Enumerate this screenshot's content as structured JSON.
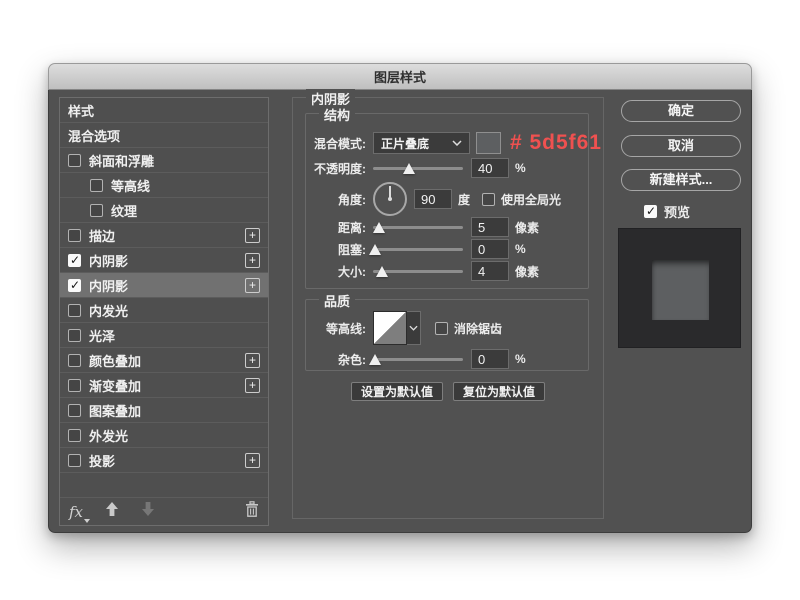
{
  "window": {
    "title": "图层样式"
  },
  "annotation": {
    "text": "# 5d5f61",
    "color": "#ef5150"
  },
  "colors": {
    "annotated_swatch": "#5d5f61",
    "dialog_bg": "#515151",
    "preview_bg": "#2a2a2c"
  },
  "sidebar": {
    "items": [
      {
        "id": "styles",
        "label": "样式"
      },
      {
        "id": "blending-options",
        "label": "混合选项"
      },
      {
        "id": "bevel-emboss",
        "label": "斜面和浮雕",
        "checkbox": true,
        "checked": false
      },
      {
        "id": "contour",
        "label": "等高线",
        "checkbox": true,
        "checked": false,
        "indent": true
      },
      {
        "id": "texture",
        "label": "纹理",
        "checkbox": true,
        "checked": false,
        "indent": true
      },
      {
        "id": "stroke",
        "label": "描边",
        "checkbox": true,
        "checked": false,
        "plus": true
      },
      {
        "id": "inner-shadow-1",
        "label": "内阴影",
        "checkbox": true,
        "checked": true,
        "plus": true
      },
      {
        "id": "inner-shadow-2",
        "label": "内阴影",
        "checkbox": true,
        "checked": true,
        "plus": true,
        "selected": true
      },
      {
        "id": "inner-glow",
        "label": "内发光",
        "checkbox": true,
        "checked": false
      },
      {
        "id": "satin",
        "label": "光泽",
        "checkbox": true,
        "checked": false
      },
      {
        "id": "color-overlay",
        "label": "颜色叠加",
        "checkbox": true,
        "checked": false,
        "plus": true
      },
      {
        "id": "gradient-overlay",
        "label": "渐变叠加",
        "checkbox": true,
        "checked": false,
        "plus": true
      },
      {
        "id": "pattern-overlay",
        "label": "图案叠加",
        "checkbox": true,
        "checked": false
      },
      {
        "id": "outer-glow",
        "label": "外发光",
        "checkbox": true,
        "checked": false
      },
      {
        "id": "drop-shadow",
        "label": "投影",
        "checkbox": true,
        "checked": false,
        "plus": true
      }
    ],
    "footer": {
      "fx_label": "fx"
    }
  },
  "panel": {
    "title": "内阴影",
    "structure": {
      "legend": "结构",
      "blend_mode": {
        "label": "混合模式:",
        "value": "正片叠底"
      },
      "opacity": {
        "label": "不透明度:",
        "value": "40",
        "unit": "%",
        "percent": 40
      },
      "angle": {
        "label": "角度:",
        "value": "90",
        "unit": "度",
        "checkbox_label": "使用全局光",
        "checked": false
      },
      "distance": {
        "label": "距离:",
        "value": "5",
        "unit": "像素",
        "percent": 7
      },
      "choke": {
        "label": "阻塞:",
        "value": "0",
        "unit": "%",
        "percent": 2
      },
      "size": {
        "label": "大小:",
        "value": "4",
        "unit": "像素",
        "percent": 10
      }
    },
    "quality": {
      "legend": "品质",
      "contour_label": "等高线:",
      "antialias_label": "消除锯齿",
      "antialias_checked": false,
      "noise": {
        "label": "杂色:",
        "value": "0",
        "unit": "%",
        "percent": 2
      }
    },
    "default_buttons": {
      "make_default": "设置为默认值",
      "reset_default": "复位为默认值"
    }
  },
  "actions": {
    "ok": "确定",
    "cancel": "取消",
    "new_style": "新建样式...",
    "preview_label": "预览",
    "preview_checked": true
  }
}
